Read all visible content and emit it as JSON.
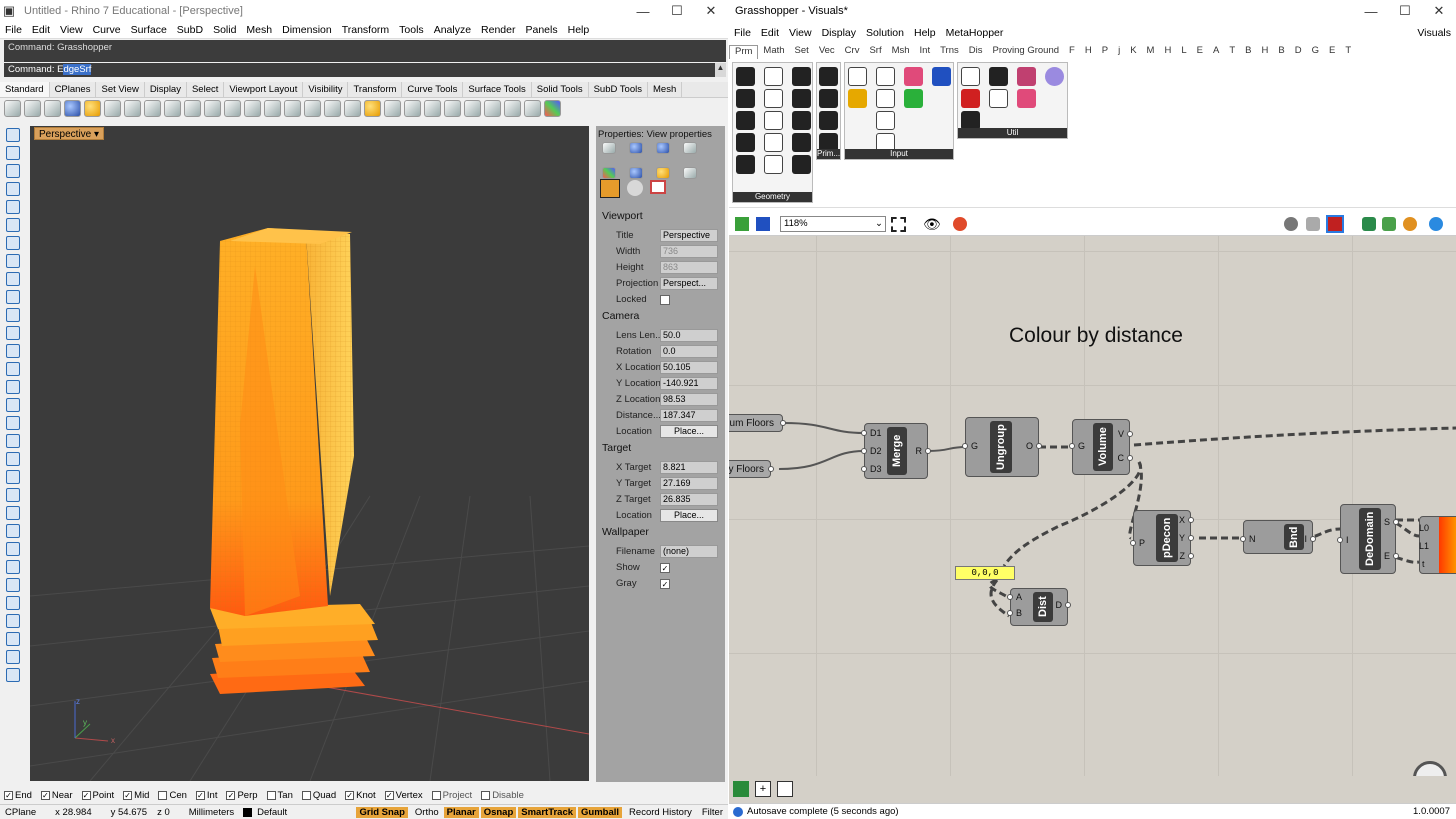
{
  "rhino": {
    "title": "Untitled - Rhino 7 Educational - [Perspective]",
    "menu": [
      "File",
      "Edit",
      "View",
      "Curve",
      "Surface",
      "SubD",
      "Solid",
      "Mesh",
      "Dimension",
      "Transform",
      "Tools",
      "Analyze",
      "Render",
      "Panels",
      "Help"
    ],
    "command_history": "Command: Grasshopper",
    "command_prompt": "Command: ",
    "command_first": "E",
    "command_selected": "dgeSrf",
    "toolbar_tabs": [
      "Standard",
      "CPlanes",
      "Set View",
      "Display",
      "Select",
      "Viewport Layout",
      "Visibility",
      "Transform",
      "Curve Tools",
      "Surface Tools",
      "Solid Tools",
      "SubD Tools",
      "Mesh"
    ],
    "viewport_label": "Perspective",
    "axis": {
      "x": "x",
      "y": "y",
      "z": "z"
    },
    "props_title": "Properties: View properties",
    "sections": {
      "viewport": "Viewport",
      "camera": "Camera",
      "target": "Target",
      "wallpaper": "Wallpaper"
    },
    "viewport_props": [
      {
        "k": "Title",
        "v": "Perspective"
      },
      {
        "k": "Width",
        "v": "736"
      },
      {
        "k": "Height",
        "v": "863"
      },
      {
        "k": "Projection",
        "v": "Perspect..."
      },
      {
        "k": "Locked",
        "v": ""
      }
    ],
    "camera_props": [
      {
        "k": "Lens Len...",
        "v": "50.0"
      },
      {
        "k": "Rotation",
        "v": "0.0"
      },
      {
        "k": "X Location",
        "v": "50.105"
      },
      {
        "k": "Y Location",
        "v": "-140.921"
      },
      {
        "k": "Z Location",
        "v": "98.53"
      },
      {
        "k": "Distance...",
        "v": "187.347"
      },
      {
        "k": "Location",
        "v": "Place..."
      }
    ],
    "target_props": [
      {
        "k": "X Target",
        "v": "8.821"
      },
      {
        "k": "Y Target",
        "v": "27.169"
      },
      {
        "k": "Z Target",
        "v": "26.835"
      },
      {
        "k": "Location",
        "v": "Place..."
      }
    ],
    "wallpaper_props": [
      {
        "k": "Filename",
        "v": "(none)"
      },
      {
        "k": "Show",
        "v": ""
      },
      {
        "k": "Gray",
        "v": ""
      }
    ],
    "osnaps": [
      {
        "label": "End",
        "on": true
      },
      {
        "label": "Near",
        "on": true
      },
      {
        "label": "Point",
        "on": true
      },
      {
        "label": "Mid",
        "on": true
      },
      {
        "label": "Cen",
        "on": false
      },
      {
        "label": "Int",
        "on": true
      },
      {
        "label": "Perp",
        "on": true
      },
      {
        "label": "Tan",
        "on": false
      },
      {
        "label": "Quad",
        "on": false
      },
      {
        "label": "Knot",
        "on": true
      },
      {
        "label": "Vertex",
        "on": true
      },
      {
        "label": "Project",
        "on": false
      },
      {
        "label": "Disable",
        "on": false
      }
    ],
    "status": {
      "cplane": "CPlane",
      "x": "x 28.984",
      "y": "y 54.675",
      "z": "z 0",
      "units": "Millimeters",
      "layer": "Default",
      "toggles": [
        {
          "label": "Grid Snap",
          "on": true
        },
        {
          "label": "Ortho",
          "on": false
        },
        {
          "label": "Planar",
          "on": true
        },
        {
          "label": "Osnap",
          "on": true
        },
        {
          "label": "SmartTrack",
          "on": true
        },
        {
          "label": "Gumball",
          "on": true
        },
        {
          "label": "Record History",
          "on": false
        },
        {
          "label": "Filter",
          "on": false
        }
      ]
    }
  },
  "gh": {
    "title": "Grasshopper - Visuals*",
    "menu": [
      "File",
      "Edit",
      "View",
      "Display",
      "Solution",
      "Help",
      "MetaHopper"
    ],
    "doc_name": "Visuals",
    "tabs": [
      "Prm",
      "Math",
      "Set",
      "Vec",
      "Crv",
      "Srf",
      "Msh",
      "Int",
      "Trns",
      "Dis",
      "Proving Ground",
      "F",
      "H",
      "P",
      "j",
      "K",
      "M",
      "H",
      "L",
      "E",
      "A",
      "T",
      "B",
      "H",
      "B",
      "D",
      "G",
      "E",
      "T"
    ],
    "groups": {
      "geometry": "Geometry",
      "prim": "Prim...",
      "input": "Input",
      "util": "Util"
    },
    "zoom": "118%",
    "canvas_title": "Colour by distance",
    "panel_value": "0,0,0",
    "comps": {
      "merge": {
        "name": "Merge",
        "in": [
          "D1",
          "D2",
          "D3"
        ],
        "out": [
          "R"
        ]
      },
      "ungroup": {
        "name": "Ungroup",
        "in": [
          "G"
        ],
        "out": [
          "O"
        ]
      },
      "volume": {
        "name": "Volume",
        "in": [
          "G"
        ],
        "out": [
          "V",
          "C"
        ]
      },
      "pdecon": {
        "name": "pDecon",
        "in": [
          "P"
        ],
        "out": [
          "X",
          "Y",
          "Z"
        ]
      },
      "bnd": {
        "name": "Bnd",
        "in": [
          "N"
        ],
        "out": [
          "I"
        ]
      },
      "dedomain": {
        "name": "DeDomain",
        "in": [
          "I"
        ],
        "out": [
          "S",
          "E"
        ]
      },
      "dist": {
        "name": "Dist",
        "in": [
          "A",
          "B"
        ],
        "out": [
          "D"
        ]
      },
      "grad": {
        "out": [
          "L0",
          "L1",
          "t"
        ]
      }
    },
    "params": {
      "p1": "ium Floors",
      "p2": "y Floors"
    },
    "status": "Autosave complete (5 seconds ago)",
    "version": "1.0.0007"
  }
}
